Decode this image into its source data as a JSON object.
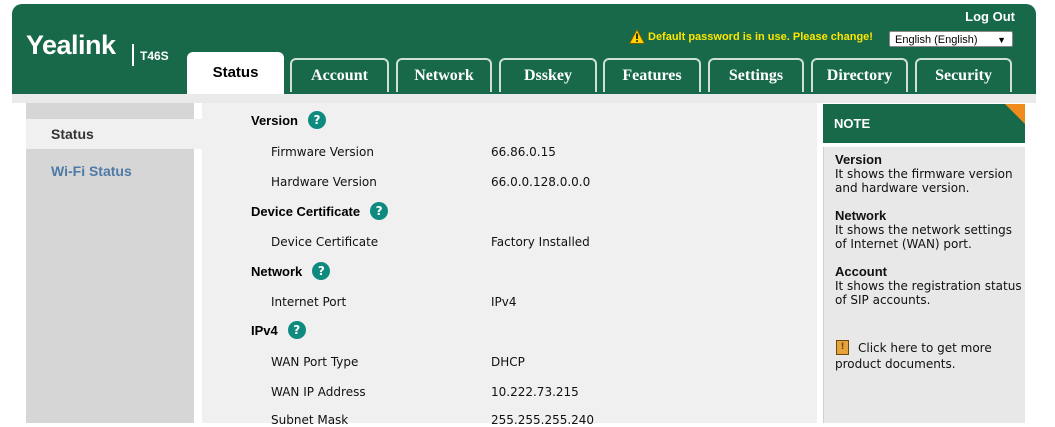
{
  "header": {
    "brand": "Yealink",
    "model": "T46S",
    "logout": "Log Out",
    "warning": "Default password is in use. Please change!",
    "language": "English (English)"
  },
  "tabs": [
    {
      "label": "Status",
      "active": true
    },
    {
      "label": "Account"
    },
    {
      "label": "Network"
    },
    {
      "label": "Dsskey"
    },
    {
      "label": "Features"
    },
    {
      "label": "Settings"
    },
    {
      "label": "Directory"
    },
    {
      "label": "Security"
    }
  ],
  "leftmenu": {
    "items": [
      {
        "label": "Status"
      },
      {
        "label": "Wi-Fi Status"
      }
    ]
  },
  "sections": {
    "version": {
      "title": "Version",
      "rows": [
        {
          "label": "Firmware Version",
          "value": "66.86.0.15"
        },
        {
          "label": "Hardware Version",
          "value": "66.0.0.128.0.0.0"
        }
      ]
    },
    "certificate": {
      "title": "Device Certificate",
      "rows": [
        {
          "label": "Device Certificate",
          "value": "Factory Installed"
        }
      ]
    },
    "network": {
      "title": "Network",
      "rows": [
        {
          "label": "Internet Port",
          "value": "IPv4"
        }
      ]
    },
    "ipv4": {
      "title": "IPv4",
      "rows": [
        {
          "label": "WAN Port Type",
          "value": "DHCP"
        },
        {
          "label": "WAN IP Address",
          "value": "10.222.73.215"
        },
        {
          "label": "Subnet Mask",
          "value": "255.255.255.240"
        }
      ]
    }
  },
  "note": {
    "title": "NOTE",
    "items": [
      {
        "title": "Version",
        "line1": "It shows the firmware version",
        "line2": "and hardware version."
      },
      {
        "title": "Network",
        "line1": "It shows the network settings",
        "line2": "of Internet (WAN) port."
      },
      {
        "title": "Account",
        "line1": "It shows the registration status",
        "line2": "of SIP accounts."
      }
    ],
    "docs_line1": "Click here to get more",
    "docs_line2": "product documents."
  },
  "colors": {
    "brand_green": "#17694a",
    "warning_yellow": "#ffe600",
    "help_teal": "#0f8a7f",
    "note_corner_orange": "#f08b1d",
    "menu_link_blue": "#4d7aa6"
  }
}
